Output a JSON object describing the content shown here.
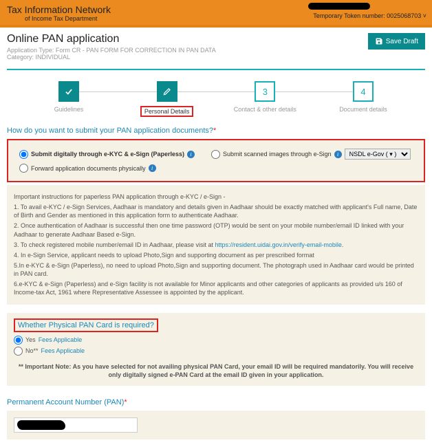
{
  "header": {
    "title": "Tax Information Network",
    "subtitle": "of Income Tax Department",
    "token_label": "Temporary Token number: 0025068703 ˅"
  },
  "page": {
    "title": "Online PAN application",
    "app_type_label": "Application Type:",
    "app_type_value": "Form CR - PAN FORM FOR CORRECTION IN PAN DATA",
    "category_label": "Category:",
    "category_value": "INDIVIDUAL",
    "save_draft": "Save Draft"
  },
  "steps": {
    "s1": "Guidelines",
    "s2": "Personal Details",
    "s3_num": "3",
    "s3": "Contact & other details",
    "s4_num": "4",
    "s4": "Document details"
  },
  "submit_q": "How do you want to submit your PAN application documents?",
  "options": {
    "o1": "Submit digitally through e-KYC & e-Sign (Paperless)",
    "o2": "Submit scanned images through e-Sign",
    "o2_sel": "NSDL e-Gov ( ▾ )",
    "o3": "Forward application documents physically"
  },
  "instr": {
    "lead": "Important instructions for paperless PAN application through e-KYC / e-Sign -",
    "p1": "1. To avail e-KYC / e-Sign Services, Aadhaar is mandatory and details given in Aadhaar should be exactly matched with applicant's Full name, Date of Birth and Gender as mentioned in this application form to authenticate Aadhaar.",
    "p2": "2. Once authentication of Aadhaar is successful then one time password (OTP) would be sent on your mobile number/email ID linked with your Aadhaar to generate Aadhaar Based e-Sign.",
    "p3a": "3. To check registered mobile number/email ID in Aadhaar, please visit at ",
    "p3_link": "https://resident.uidai.gov.in/verify-email-mobile",
    "p3b": ".",
    "p4": "4. In e-Sign Service, applicant needs to upload Photo,Sign and supporting document as per prescribed format",
    "p5": "5.In e-KYC & e-Sign (Paperless), no need to upload Photo,Sign and supporting document. The photograph used in Aadhaar card would be printed in PAN card.",
    "p6": "6.e-KYC & e-Sign (Paperless) and e-Sign facility is not available for Minor applicants and other categories of applicants as provided u/s 160 of Income-tax Act, 1961 where Representative Assessee is appointed by the applicant."
  },
  "physical": {
    "heading": "Whether Physical PAN Card is required?",
    "yes": "Yes",
    "no": "No**",
    "fees": "Fees Applicable",
    "note": "** Important Note: As you have selected for not availing physical PAN Card, your email ID will be required mandatorily. You will receive only digitally signed e-PAN Card at the email ID given in your application."
  },
  "pan": {
    "heading": "Permanent Account Number (PAN)"
  }
}
